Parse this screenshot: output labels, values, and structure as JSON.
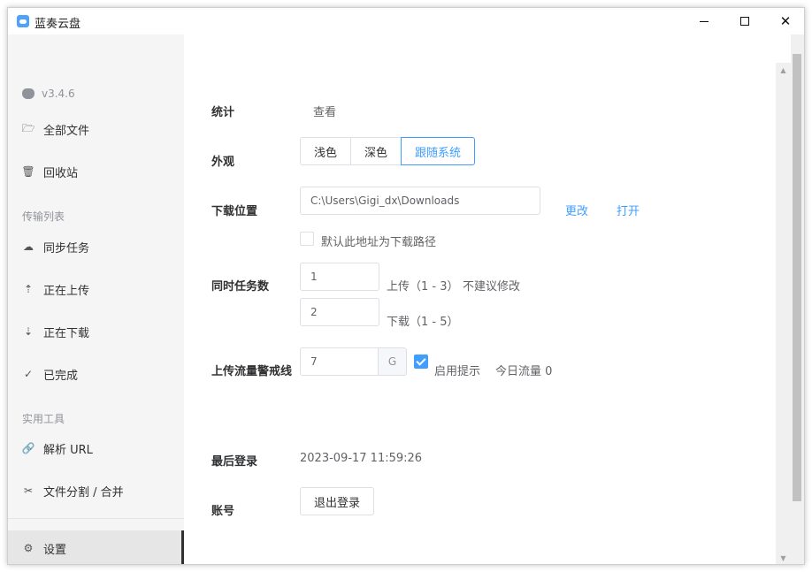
{
  "window": {
    "title": "蓝奏云盘",
    "minimize_icon": "minimize-icon",
    "maximize_icon": "maximize-icon",
    "close_icon": "close-icon",
    "close_glyph": "✕"
  },
  "sidebar": {
    "version": "v3.4.6",
    "items": [
      {
        "label": "全部文件",
        "icon": "folder-open-icon",
        "glyph": "🗁"
      },
      {
        "label": "回收站",
        "icon": "trash-icon",
        "glyph": "🗑"
      }
    ],
    "group_transfer": "传输列表",
    "transfer_items": [
      {
        "label": "同步任务",
        "icon": "cloud-sync-icon",
        "glyph": "☁"
      },
      {
        "label": "正在上传",
        "icon": "cloud-upload-icon",
        "glyph": "⇡"
      },
      {
        "label": "正在下载",
        "icon": "cloud-download-icon",
        "glyph": "⇣"
      },
      {
        "label": "已完成",
        "icon": "check-circle-icon",
        "glyph": "✓"
      }
    ],
    "group_tools": "实用工具",
    "tool_items": [
      {
        "label": "解析 URL",
        "icon": "link-icon",
        "glyph": "🔗"
      },
      {
        "label": "文件分割 / 合并",
        "icon": "scissors-icon",
        "glyph": "✂"
      }
    ],
    "settings": {
      "label": "设置",
      "icon": "gear-icon",
      "glyph": "⚙"
    }
  },
  "settings": {
    "stats": {
      "label": "统计",
      "action": "查看"
    },
    "appearance": {
      "label": "外观",
      "options": [
        "浅色",
        "深色",
        "跟随系统"
      ],
      "selected": "跟随系统"
    },
    "download_location": {
      "label": "下载位置",
      "path": "C:\\Users\\Gigi_dx\\Downloads",
      "change": "更改",
      "open": "打开",
      "default_checkbox_label": "默认此地址为下载路径",
      "default_checked": false
    },
    "concurrent": {
      "label": "同时任务数",
      "upload_value": "1",
      "upload_label": "上传（1 - 3）",
      "upload_hint": "不建议修改",
      "download_value": "2",
      "download_label": "下载（1 - 5）"
    },
    "upload_limit": {
      "label": "上传流量警戒线",
      "value": "7",
      "unit": "G",
      "hint_checked": true,
      "hint_label": "启用提示",
      "today_traffic": "今日流量 0"
    },
    "last_login": {
      "label": "最后登录",
      "value": "2023-09-17 11:59:26"
    },
    "account": {
      "label": "账号",
      "logout": "退出登录"
    }
  }
}
